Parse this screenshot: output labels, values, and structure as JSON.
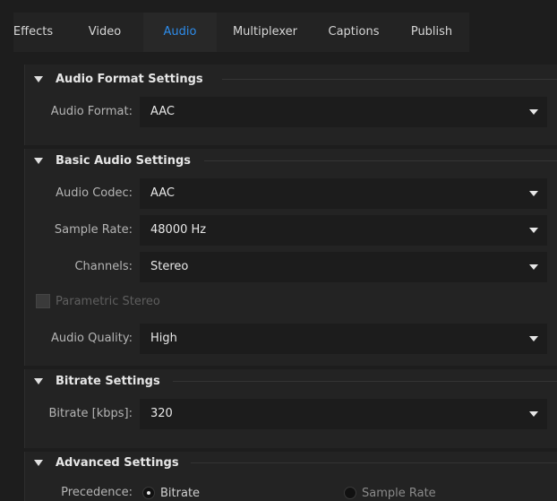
{
  "tabs": [
    {
      "label": "Effects"
    },
    {
      "label": "Video"
    },
    {
      "label": "Audio"
    },
    {
      "label": "Multiplexer"
    },
    {
      "label": "Captions"
    },
    {
      "label": "Publish"
    }
  ],
  "active_tab": "Audio",
  "accent_color": "#2d8ceb",
  "sections": {
    "audio_format": {
      "title": "Audio Format Settings",
      "format_label": "Audio Format:",
      "format_value": "AAC"
    },
    "basic_audio": {
      "title": "Basic Audio Settings",
      "codec_label": "Audio Codec:",
      "codec_value": "AAC",
      "sample_rate_label": "Sample Rate:",
      "sample_rate_value": "48000 Hz",
      "channels_label": "Channels:",
      "channels_value": "Stereo",
      "parametric_stereo_label": "Parametric Stereo",
      "parametric_stereo_checked": false,
      "quality_label": "Audio Quality:",
      "quality_value": "High"
    },
    "bitrate": {
      "title": "Bitrate Settings",
      "bitrate_label": "Bitrate [kbps]:",
      "bitrate_value": "320"
    },
    "advanced": {
      "title": "Advanced Settings",
      "precedence_label": "Precedence:",
      "option_bitrate": "Bitrate",
      "option_sample_rate": "Sample Rate",
      "selected": "Bitrate"
    }
  },
  "icons": {
    "collapse": "triangle-down-icon",
    "dropdown": "chevron-down-icon"
  }
}
